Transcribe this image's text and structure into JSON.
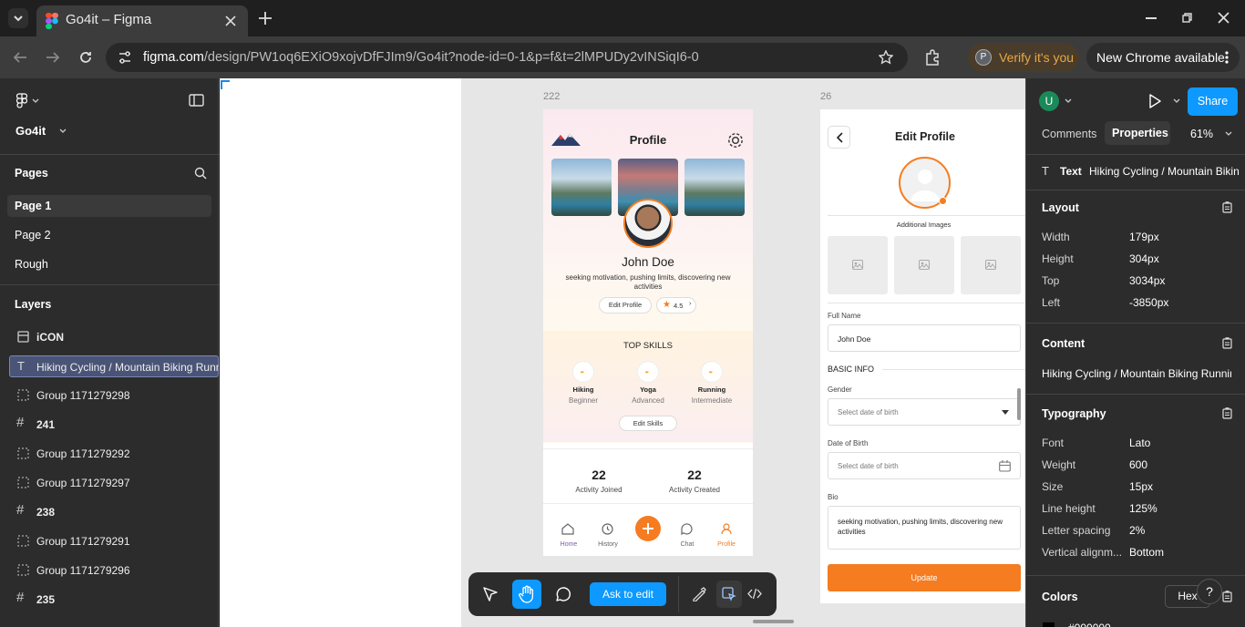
{
  "browser": {
    "tab_title": "Go4it – Figma",
    "url_host": "figma.com",
    "url_path": "/design/PW1oq6EXiO9xojvDfFJIm9/Go4it?node-id=0-1&p=f&t=2lMPUDy2vINSiqI6-0",
    "verify_label": "Verify it's you",
    "profile_initial": "P",
    "new_chrome_label": "New Chrome available"
  },
  "left_panel": {
    "file_name": "Go4it",
    "pages_heading": "Pages",
    "pages": [
      "Page 1",
      "Page 2",
      "Rough"
    ],
    "layers_heading": "Layers",
    "layers": [
      {
        "icon": "component",
        "label": "iCON"
      },
      {
        "icon": "text",
        "label": "Hiking Cycling / Mountain Biking Running"
      },
      {
        "icon": "group",
        "label": "Group 1171279298"
      },
      {
        "icon": "frame",
        "label": "241"
      },
      {
        "icon": "group",
        "label": "Group 1171279292"
      },
      {
        "icon": "group",
        "label": "Group 1171279297"
      },
      {
        "icon": "frame",
        "label": "238"
      },
      {
        "icon": "group",
        "label": "Group 1171279291"
      },
      {
        "icon": "group",
        "label": "Group 1171279296"
      },
      {
        "icon": "frame",
        "label": "235"
      }
    ]
  },
  "canvas": {
    "frame_a_label": "222",
    "frame_b_label": "26",
    "profile": {
      "title": "Profile",
      "name": "John Doe",
      "bio": "seeking motivation, pushing limits, discovering new activities",
      "edit_button": "Edit Profile",
      "rating": "4.5",
      "top_skills_heading": "TOP SKILLS",
      "skills": [
        {
          "name": "Hiking",
          "level": "Beginner"
        },
        {
          "name": "Yoga",
          "level": "Advanced"
        },
        {
          "name": "Running",
          "level": "Intermediate"
        }
      ],
      "edit_skills_button": "Edit Skills",
      "stats": [
        {
          "value": "22",
          "label": "Activity Joined"
        },
        {
          "value": "22",
          "label": "Activity Created"
        }
      ],
      "nav": [
        "Home",
        "History",
        "Chat",
        "Profile"
      ],
      "accent": "#f57c20"
    },
    "edit_profile": {
      "title": "Edit Profile",
      "additional_images": "Additional Images",
      "full_name_label": "Full Name",
      "full_name_value": "John Doe",
      "basic_info": "BASIC INFO",
      "gender_label": "Gender",
      "gender_placeholder": "Select date of birth",
      "dob_label": "Date of Birth",
      "dob_placeholder": "Select date of birth",
      "bio_label": "Bio",
      "bio_value": "seeking motivation, pushing limits, discovering new activities",
      "update_button": "Update"
    }
  },
  "toolbar": {
    "ask_to_edit": "Ask to edit"
  },
  "right_panel": {
    "user_initial": "U",
    "share_label": "Share",
    "tabs": [
      "Comments",
      "Properties"
    ],
    "zoom": "61%",
    "selection_type": "Text",
    "selection_name": "Hiking Cycling / Mountain Biking",
    "layout_heading": "Layout",
    "layout": [
      {
        "label": "Width",
        "value": "179px"
      },
      {
        "label": "Height",
        "value": "304px"
      },
      {
        "label": "Top",
        "value": "3034px"
      },
      {
        "label": "Left",
        "value": "-3850px"
      }
    ],
    "content_heading": "Content",
    "content_value": "Hiking Cycling / Mountain Biking Running",
    "typography_heading": "Typography",
    "typography": [
      {
        "label": "Font",
        "value": "Lato"
      },
      {
        "label": "Weight",
        "value": "600"
      },
      {
        "label": "Size",
        "value": "15px"
      },
      {
        "label": "Line height",
        "value": "125%"
      },
      {
        "label": "Letter spacing",
        "value": "2%"
      },
      {
        "label": "Vertical alignm...",
        "value": "Bottom"
      }
    ],
    "colors_heading": "Colors",
    "color_format": "Hex",
    "color_value_partial": "#000000"
  }
}
